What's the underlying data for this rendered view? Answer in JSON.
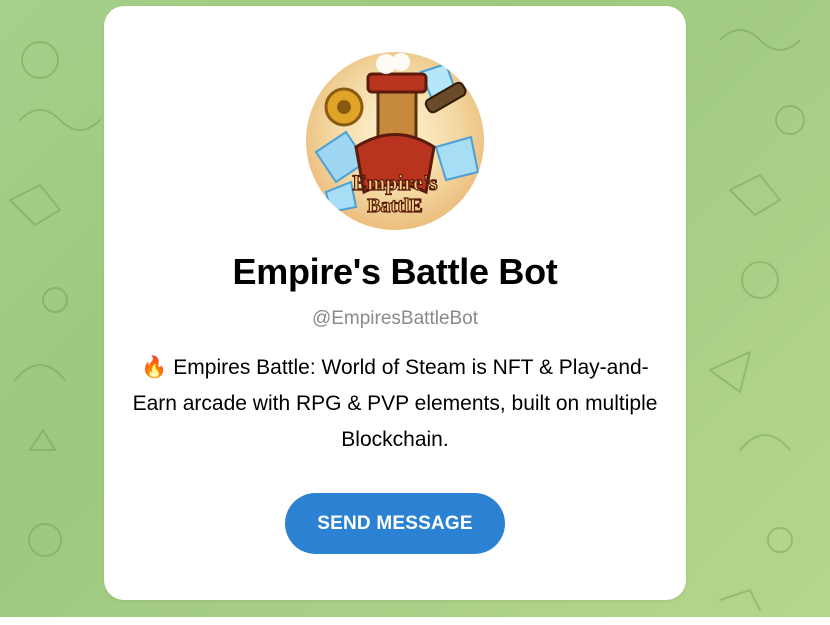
{
  "bot": {
    "avatar_icon": "empires-battle-logo",
    "avatar_text_line1": "Empire's",
    "avatar_text_line2": "BattlE",
    "title": "Empire's Battle Bot",
    "username": "@EmpiresBattleBot",
    "description_emoji": "🔥",
    "description": "Empires Battle: World of Steam is NFT & Play-and-Earn arcade with RPG & PVP elements, built on multiple Blockchain."
  },
  "actions": {
    "send_message_label": "SEND MESSAGE"
  },
  "colors": {
    "background": "#a6d08a",
    "card": "#ffffff",
    "button": "#2b82d3",
    "username": "#8a8a8a"
  }
}
